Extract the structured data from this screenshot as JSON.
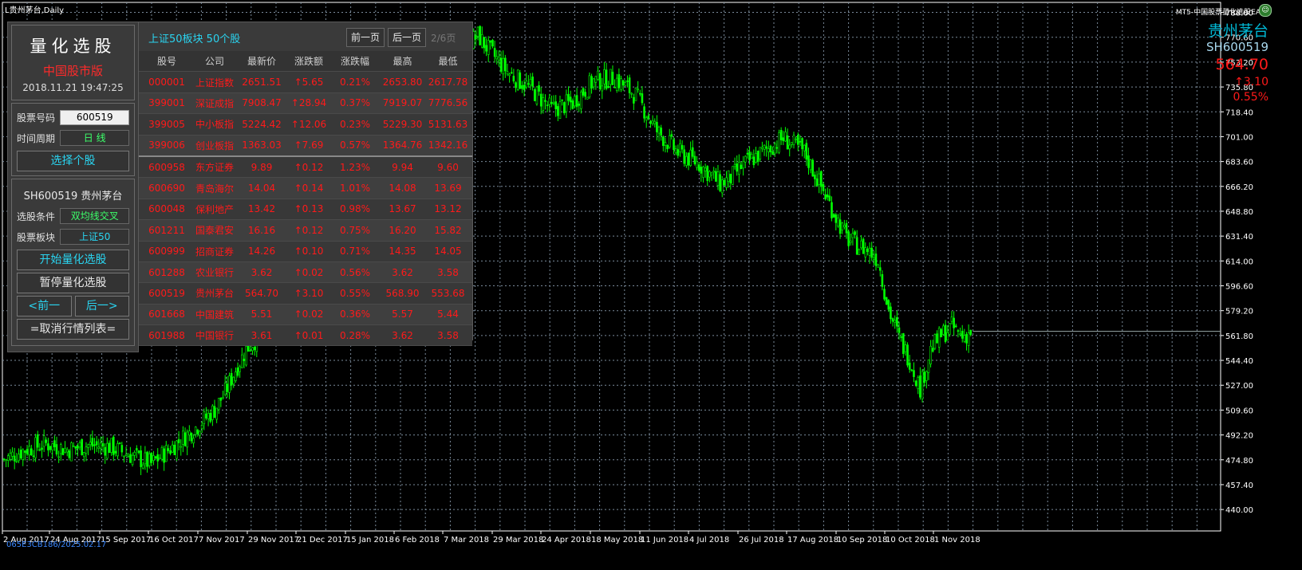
{
  "window_title": "L贵州茅台,Daily",
  "ea_name": "MT5-中国股票量化选股EA",
  "symbol": {
    "name_cn": "贵州茅台",
    "code": "SH600519",
    "price": "564.70",
    "change": "↑3.10",
    "change_pct": "0.55%"
  },
  "stamp": "065E3CB186/2025.02.17",
  "left_panel": {
    "title": "量化选股",
    "subtitle": "中国股市版",
    "datetime": "2018.11.21 19:47:25",
    "stock_code_label": "股票号码",
    "stock_code_value": "600519",
    "period_label": "时间周期",
    "period_value": "日 线",
    "select_button": "选择个股",
    "stock_display": "SH600519 贵州茅台",
    "condition_label": "选股条件",
    "condition_value": "双均线交叉",
    "sector_label": "股票板块",
    "sector_value": "上证50",
    "start_button": "开始量化选股",
    "pause_button": "暂停量化选股",
    "prev_button": "<前一",
    "next_button": "后一>",
    "cancel_button": "=取消行情列表="
  },
  "table_panel": {
    "caption": "上证50板块 50个股",
    "prev_page": "前一页",
    "next_page": "后一页",
    "page_indicator": "2/6页",
    "headers": [
      "股号",
      "公司",
      "最新价",
      "涨跌额",
      "涨跌幅",
      "最高",
      "最低"
    ],
    "rows": [
      [
        "000001",
        "上证指数",
        "2651.51",
        "↑5.65",
        "0.21%",
        "2653.80",
        "2617.78"
      ],
      [
        "399001",
        "深证成指",
        "7908.47",
        "↑28.94",
        "0.37%",
        "7919.07",
        "7776.56"
      ],
      [
        "399005",
        "中小板指",
        "5224.42",
        "↑12.06",
        "0.23%",
        "5229.30",
        "5131.63"
      ],
      [
        "399006",
        "创业板指",
        "1363.03",
        "↑7.69",
        "0.57%",
        "1364.76",
        "1342.16"
      ],
      [
        "600958",
        "东方证券",
        "9.89",
        "↑0.12",
        "1.23%",
        "9.94",
        "9.60"
      ],
      [
        "600690",
        "青岛海尔",
        "14.04",
        "↑0.14",
        "1.01%",
        "14.08",
        "13.69"
      ],
      [
        "600048",
        "保利地产",
        "13.42",
        "↑0.13",
        "0.98%",
        "13.67",
        "13.12"
      ],
      [
        "601211",
        "国泰君安",
        "16.16",
        "↑0.12",
        "0.75%",
        "16.20",
        "15.82"
      ],
      [
        "600999",
        "招商证券",
        "14.26",
        "↑0.10",
        "0.71%",
        "14.35",
        "14.05"
      ],
      [
        "601288",
        "农业银行",
        "3.62",
        "↑0.02",
        "0.56%",
        "3.62",
        "3.58"
      ],
      [
        "600519",
        "贵州茅台",
        "564.70",
        "↑3.10",
        "0.55%",
        "568.90",
        "553.68"
      ],
      [
        "601668",
        "中国建筑",
        "5.51",
        "↑0.02",
        "0.36%",
        "5.57",
        "5.44"
      ],
      [
        "601988",
        "中国银行",
        "3.61",
        "↑0.01",
        "0.28%",
        "3.62",
        "3.58"
      ]
    ]
  },
  "chart_data": {
    "type": "candlestick",
    "ylim": [
      425,
      795
    ],
    "y_ticks": [
      "788.00",
      "770.60",
      "753.20",
      "735.80",
      "718.40",
      "701.00",
      "683.60",
      "666.20",
      "648.80",
      "631.40",
      "614.00",
      "596.60",
      "579.20",
      "561.80",
      "544.40",
      "527.00",
      "509.60",
      "492.20",
      "474.80",
      "457.40",
      "440.00"
    ],
    "x_ticks": [
      "2 Aug 2017",
      "24 Aug 2017",
      "15 Sep 2017",
      "16 Oct 2017",
      "7 Nov 2017",
      "29 Nov 2017",
      "21 Dec 2017",
      "15 Jan 2018",
      "6 Feb 2018",
      "7 Mar 2018",
      "29 Mar 2018",
      "24 Apr 2018",
      "18 May 2018",
      "11 Jun 2018",
      "4 Jul 2018",
      "26 Jul 2018",
      "17 Aug 2018",
      "10 Sep 2018",
      "10 Oct 2018",
      "1 Nov 2018"
    ],
    "close_path": [
      [
        0,
        475
      ],
      [
        10,
        482
      ],
      [
        20,
        486
      ],
      [
        30,
        482
      ],
      [
        40,
        485
      ],
      [
        50,
        484
      ],
      [
        60,
        478
      ],
      [
        70,
        472
      ],
      [
        80,
        484
      ],
      [
        90,
        496
      ],
      [
        95,
        503
      ],
      [
        100,
        510
      ],
      [
        105,
        522
      ],
      [
        110,
        538
      ],
      [
        115,
        552
      ],
      [
        120,
        560
      ],
      [
        125,
        575
      ],
      [
        130,
        590
      ],
      [
        140,
        640
      ],
      [
        150,
        655
      ],
      [
        160,
        700
      ],
      [
        170,
        718
      ],
      [
        180,
        720
      ],
      [
        190,
        728
      ],
      [
        200,
        742
      ],
      [
        210,
        748
      ],
      [
        215,
        752
      ],
      [
        220,
        765
      ],
      [
        225,
        772
      ],
      [
        230,
        762
      ],
      [
        240,
        745
      ],
      [
        250,
        735
      ],
      [
        260,
        720
      ],
      [
        270,
        725
      ],
      [
        280,
        740
      ],
      [
        290,
        742
      ],
      [
        300,
        730
      ],
      [
        310,
        705
      ],
      [
        320,
        690
      ],
      [
        330,
        682
      ],
      [
        340,
        668
      ],
      [
        345,
        672
      ],
      [
        350,
        680
      ],
      [
        360,
        690
      ],
      [
        370,
        700
      ],
      [
        380,
        690
      ],
      [
        390,
        660
      ],
      [
        395,
        645
      ],
      [
        400,
        630
      ],
      [
        405,
        625
      ],
      [
        410,
        622
      ],
      [
        415,
        615
      ],
      [
        420,
        580
      ],
      [
        425,
        560
      ],
      [
        430,
        545
      ],
      [
        435,
        525
      ],
      [
        440,
        552
      ],
      [
        445,
        562
      ],
      [
        450,
        568
      ],
      [
        455,
        561
      ],
      [
        460,
        565
      ]
    ],
    "last_price": 564.7
  }
}
